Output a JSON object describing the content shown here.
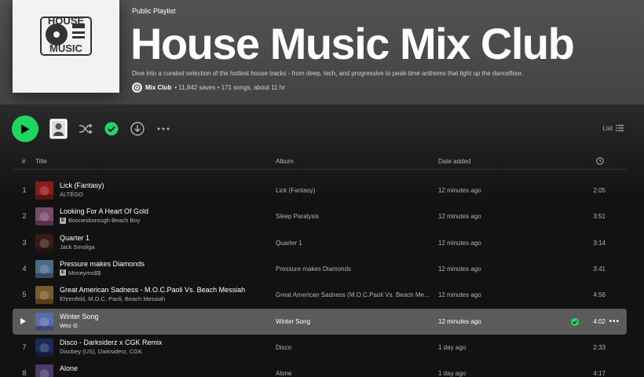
{
  "playlist": {
    "kind": "Public Playlist",
    "title": "House Music Mix Club",
    "description": "Dive into a curated selection of the hottest house tracks - from deep, tech, and progressive to peak-time anthems that light up the dancefloor.",
    "owner": "Mix Club",
    "stats": "• 11,842 saves • 171 songs, about 11 hr",
    "cover_text_top": "HOUSE",
    "cover_text_bottom": "MUSIC"
  },
  "actions": {
    "view_mode_label": "List"
  },
  "table": {
    "headers": {
      "num": "#",
      "title": "Title",
      "album": "Album",
      "date_added": "Date added"
    },
    "rows": [
      {
        "num": "1",
        "title": "Lick (Fantasy)",
        "artist": "ALTÉGO",
        "explicit": false,
        "album": "Lick (Fantasy)",
        "added": "12 minutes ago",
        "duration": "2:05",
        "art_color": "#8a1a1a"
      },
      {
        "num": "2",
        "title": "Looking For A Heart Of Gold",
        "artist": "Boonesborough Beach Boy",
        "explicit": true,
        "album": "Sleep Paralysis",
        "added": "12 minutes ago",
        "duration": "3:51",
        "art_color": "#7a4a6a"
      },
      {
        "num": "3",
        "title": "Quarter 1",
        "artist": "Jack Smoliga",
        "explicit": false,
        "album": "Quarter 1",
        "added": "12 minutes ago",
        "duration": "3:14",
        "art_color": "#3a1a14"
      },
      {
        "num": "4",
        "title": "Pressure makes Diamonds",
        "artist": "Moneymo$$",
        "explicit": true,
        "album": "Pressure makes Diamonds",
        "added": "12 minutes ago",
        "duration": "3:41",
        "art_color": "#4a6a8a"
      },
      {
        "num": "5",
        "title": "Great American Sadness - M.O.C.Paoli Vs. Beach Messiah",
        "artist": "Ehrenfeld, M.O.C. Paoli, Beach Messiah",
        "explicit": false,
        "album": "Great American Sadness (M.O.C.Paoli Vs. Beach Me...",
        "added": "12 minutes ago",
        "duration": "4:56",
        "art_color": "#7a5a2a"
      },
      {
        "num": "6",
        "title": "Winter Song",
        "artist": "Wez G",
        "explicit": false,
        "album": "Winter Song",
        "added": "12 minutes ago",
        "duration": "4:02",
        "art_color": "#5a6aaa",
        "active": true
      },
      {
        "num": "7",
        "title": "Disco - Darksiderz x CGK Remix",
        "artist": "Disobey (US), Darksiderz, CGK",
        "explicit": false,
        "album": "Disco",
        "added": "1 day ago",
        "duration": "2:33",
        "art_color": "#1a2a5a"
      },
      {
        "num": "8",
        "title": "Alone",
        "artist": "",
        "explicit": false,
        "album": "Alone",
        "added": "1 day ago",
        "duration": "4:17",
        "art_color": "#4a3a6a"
      }
    ]
  },
  "colors": {
    "accent": "#1ed760",
    "background": "#121212",
    "header": "#525252"
  }
}
